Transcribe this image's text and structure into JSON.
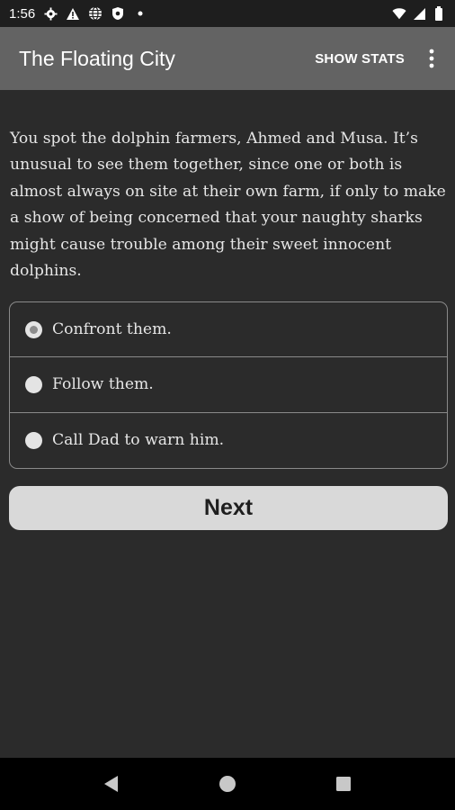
{
  "status_bar": {
    "time": "1:56",
    "left_icons": [
      "gear-icon",
      "warning-icon",
      "globe-icon",
      "shield-icon",
      "dot-icon"
    ],
    "right_icons": [
      "wifi-icon",
      "cell-signal-icon",
      "battery-icon"
    ]
  },
  "app_bar": {
    "title": "The Floating City",
    "show_stats_label": "SHOW STATS",
    "overflow_icon": "more-vertical-icon"
  },
  "story": {
    "text": "You spot the dolphin farmers, Ahmed and Musa. It’s unusual to see them together, since one or both is almost always on site at their own farm, if only to make a show of being concerned that your naughty sharks might cause trouble among their sweet innocent dolphins."
  },
  "choices": [
    {
      "label": "Confront them.",
      "selected": true
    },
    {
      "label": "Follow them.",
      "selected": false
    },
    {
      "label": "Call Dad to warn him.",
      "selected": false
    }
  ],
  "next_button": {
    "label": "Next"
  },
  "nav_bar": {
    "icons": [
      "back-icon",
      "home-icon",
      "recents-icon"
    ]
  },
  "colors": {
    "status_bar_bg": "#1e1e1e",
    "app_bar_bg": "#636363",
    "content_bg": "#2b2b2b",
    "button_bg": "#d9d9d9",
    "nav_bar_bg": "#000000"
  }
}
